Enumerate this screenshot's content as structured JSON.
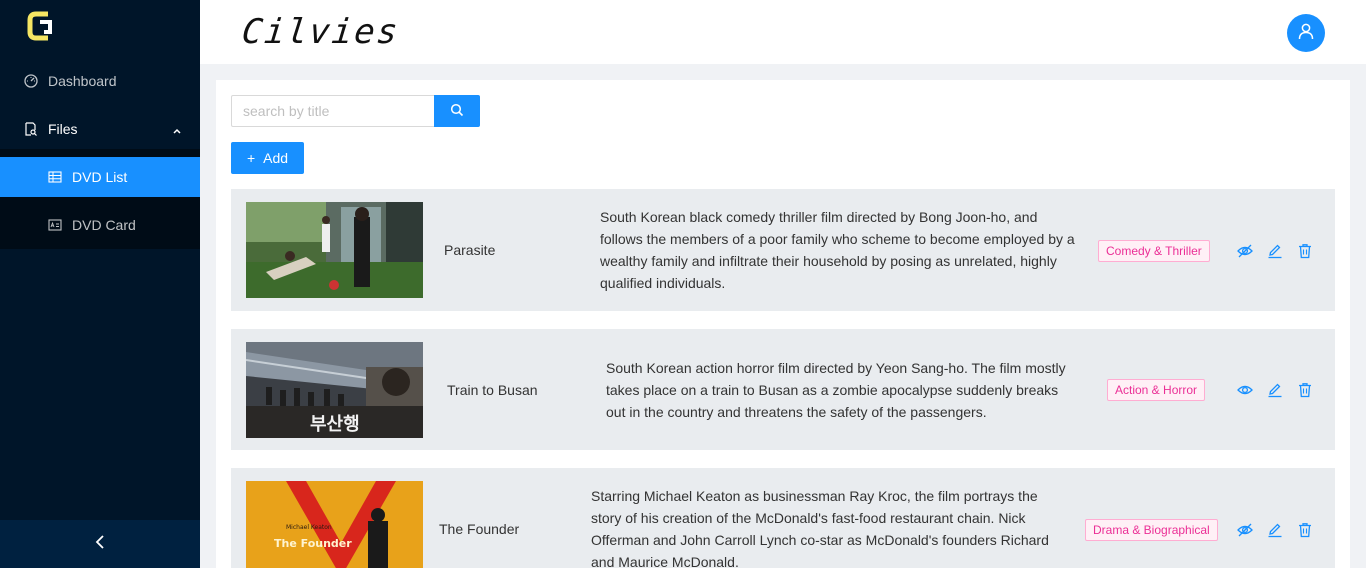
{
  "brand": {
    "name": "Cilvies",
    "logo_letter": "C"
  },
  "sidebar": {
    "items": [
      {
        "label": "Dashboard",
        "icon": "dashboard-icon"
      },
      {
        "label": "Files",
        "icon": "file-search-icon"
      },
      {
        "label": "DVD List",
        "icon": "table-icon"
      },
      {
        "label": "DVD Card",
        "icon": "card-icon"
      }
    ],
    "collapse_icon": "chevron-left-icon"
  },
  "header": {
    "avatar_icon": "user-icon"
  },
  "search": {
    "placeholder": "search by title",
    "value": "",
    "button_icon": "search-icon"
  },
  "toolbar": {
    "add_label": "Add"
  },
  "colors": {
    "primary": "#1890ff",
    "sidebar": "#001529",
    "tag_text": "#eb2f96",
    "tag_bg": "#fff0f6"
  },
  "dvds": [
    {
      "title": "Parasite",
      "description": "South Korean black comedy thriller film directed by Bong Joon-ho, and follows the members of a poor family who scheme to become employed by a wealthy family and infiltrate their household by posing as unrelated, highly qualified individuals.",
      "genre": "Comedy & Thriller",
      "visibility_icon": "eye-invisible-icon"
    },
    {
      "title": "Train to Busan",
      "description": "South Korean action horror film directed by Yeon Sang-ho. The film mostly takes place on a train to Busan as a zombie apocalypse suddenly breaks out in the country and threatens the safety of the passengers.",
      "genre": "Action & Horror",
      "visibility_icon": "eye-icon",
      "poster_text": "부산행"
    },
    {
      "title": "The Founder",
      "description": "Starring Michael Keaton as businessman Ray Kroc, the film portrays the story of his creation of the McDonald's fast-food restaurant chain. Nick Offerman and John Carroll Lynch co-star as McDonald's founders Richard and Maurice McDonald.",
      "genre": "Drama & Biographical",
      "visibility_icon": "eye-invisible-icon",
      "poster_text": "The Founder",
      "poster_subtext": "Michael Keaton"
    }
  ]
}
